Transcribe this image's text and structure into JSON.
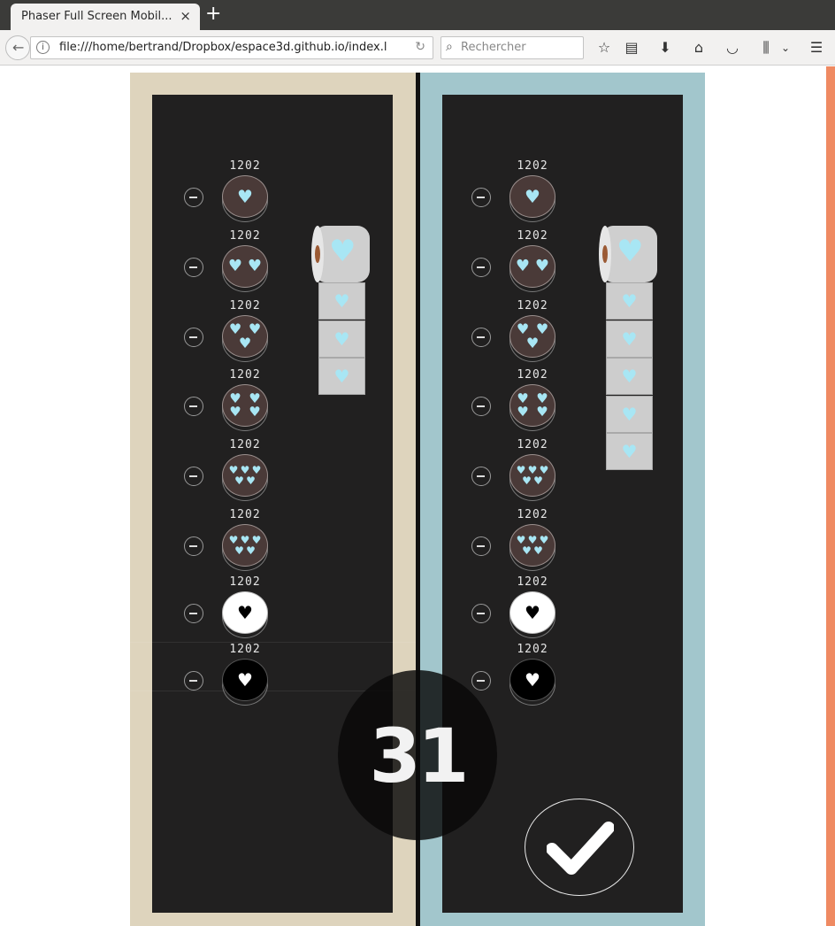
{
  "browser": {
    "tab_title": "Phaser Full Screen Mobil...",
    "tab_close": "×",
    "new_tab": "+",
    "back": "←",
    "info": "i",
    "url": "file:///home/bertrand/Dropbox/espace3d.github.io/index.l",
    "reload": "↻",
    "search_placeholder": "Rechercher",
    "search_glyph": "⌕",
    "toolbar_icons": [
      "star-icon",
      "reading-list-icon",
      "download-icon",
      "home-icon",
      "pocket-icon",
      "library-icon",
      "menu-icon"
    ]
  },
  "colors": {
    "left_panel": "#ded4bd",
    "right_panel": "#a2c6cc",
    "board": "#212020",
    "heart": "#a8e6f4",
    "accent_strip": "#ef8a62"
  },
  "game": {
    "counter": "31",
    "left": {
      "rows": [
        {
          "value": "1202",
          "hearts": 1,
          "style": "dark"
        },
        {
          "value": "1202",
          "hearts": 2,
          "style": "dark"
        },
        {
          "value": "1202",
          "hearts": 3,
          "style": "dark"
        },
        {
          "value": "1202",
          "hearts": 4,
          "style": "dark"
        },
        {
          "value": "1202",
          "hearts": 5,
          "style": "dark"
        },
        {
          "value": "1202",
          "hearts": 5,
          "style": "dark"
        },
        {
          "value": "1202",
          "hearts": 1,
          "style": "white"
        },
        {
          "value": "1202",
          "hearts": 1,
          "style": "black"
        }
      ],
      "roll_sheets": 3
    },
    "right": {
      "rows": [
        {
          "value": "1202",
          "hearts": 1,
          "style": "dark"
        },
        {
          "value": "1202",
          "hearts": 2,
          "style": "dark"
        },
        {
          "value": "1202",
          "hearts": 3,
          "style": "dark"
        },
        {
          "value": "1202",
          "hearts": 4,
          "style": "dark"
        },
        {
          "value": "1202",
          "hearts": 5,
          "style": "dark"
        },
        {
          "value": "1202",
          "hearts": 5,
          "style": "dark"
        },
        {
          "value": "1202",
          "hearts": 1,
          "style": "white"
        },
        {
          "value": "1202",
          "hearts": 1,
          "style": "black"
        }
      ],
      "roll_sheets": 5
    }
  }
}
